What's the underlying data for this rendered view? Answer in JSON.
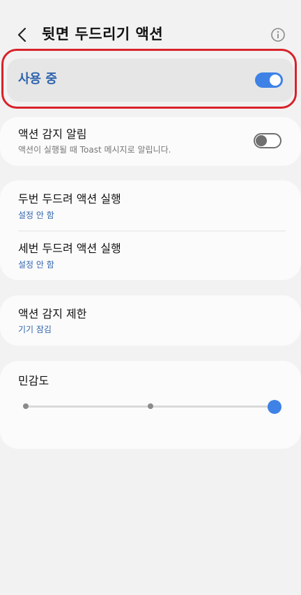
{
  "header": {
    "title": "뒷면 두드리기 액션",
    "back_icon": "chevron-left-icon",
    "info_icon": "info-icon"
  },
  "master_switch": {
    "label": "사용 중",
    "enabled": true,
    "accent_color": "#3e82e6"
  },
  "notification": {
    "title": "액션 감지 알림",
    "subtitle": "액션이 실행될 때 Toast 메시지로 알립니다.",
    "enabled": false
  },
  "tap_actions": [
    {
      "title": "두번 두드려 액션 실행",
      "value": "설정 안 함"
    },
    {
      "title": "세번 두드려 액션 실행",
      "value": "설정 안 함"
    }
  ],
  "restriction": {
    "title": "액션 감지 제한",
    "value": "기기 잠김"
  },
  "sensitivity": {
    "title": "민감도",
    "levels": 3,
    "current_level": 3
  },
  "colors": {
    "highlight_border": "#d8222a",
    "link_blue": "#2f64ad"
  }
}
